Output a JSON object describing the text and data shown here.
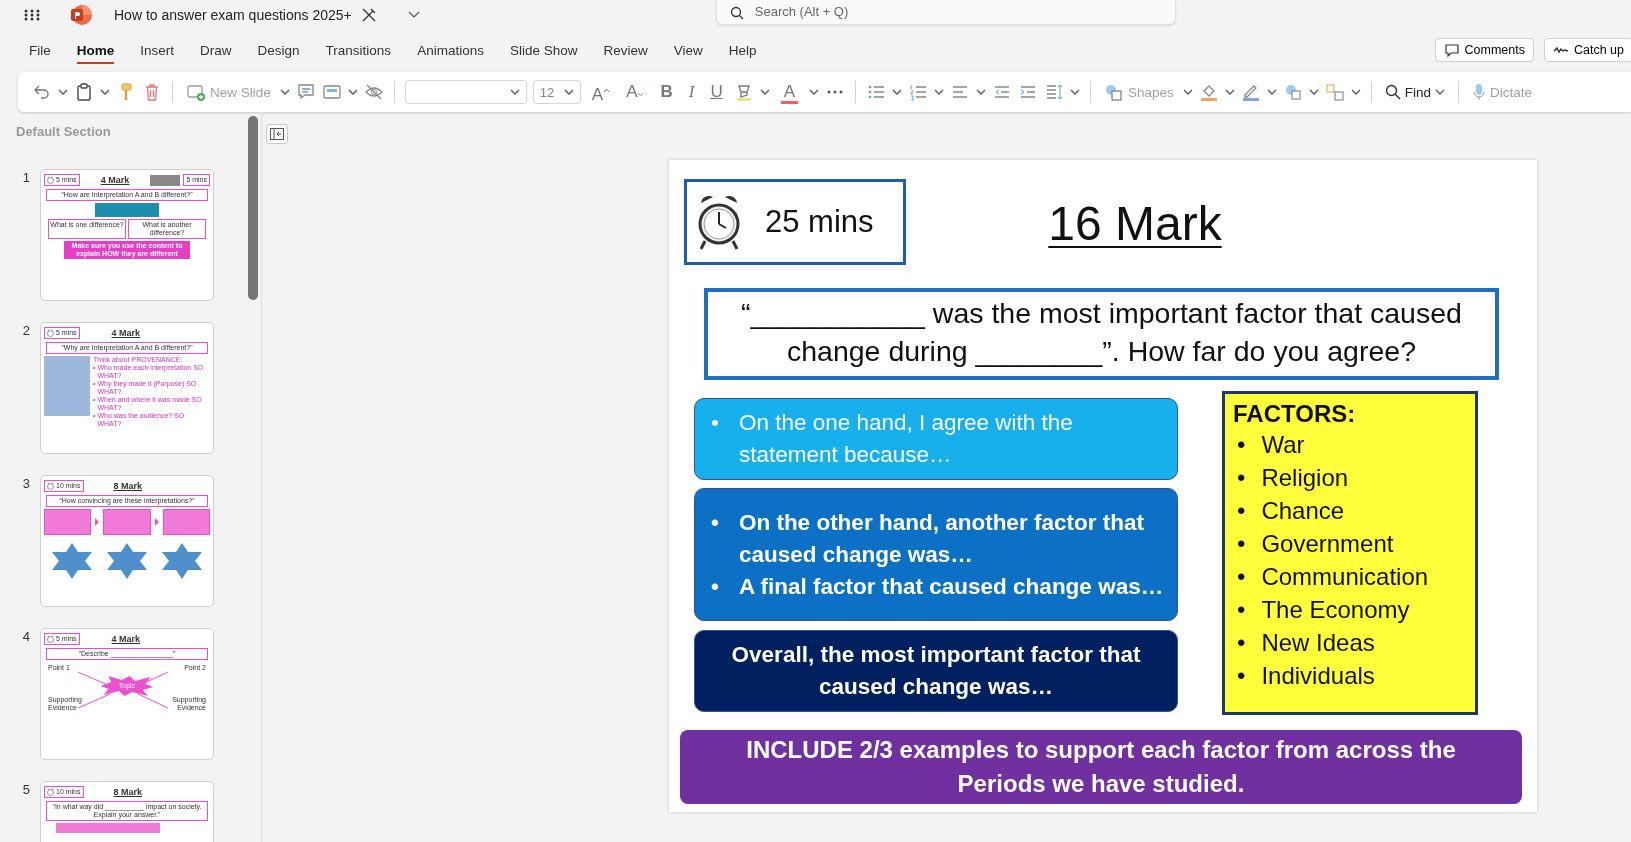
{
  "app": {
    "title": "How to answer exam questions 2025+",
    "search": {
      "placeholder": "Search (Alt + Q)"
    }
  },
  "tabs": [
    {
      "label": "File",
      "selected": false
    },
    {
      "label": "Home",
      "selected": true
    },
    {
      "label": "Insert",
      "selected": false
    },
    {
      "label": "Draw",
      "selected": false
    },
    {
      "label": "Design",
      "selected": false
    },
    {
      "label": "Transitions",
      "selected": false
    },
    {
      "label": "Animations",
      "selected": false
    },
    {
      "label": "Slide Show",
      "selected": false
    },
    {
      "label": "Review",
      "selected": false
    },
    {
      "label": "View",
      "selected": false
    },
    {
      "label": "Help",
      "selected": false
    }
  ],
  "header_buttons": [
    "Comments",
    "Catch up"
  ],
  "ribbon": {
    "new_slide": {
      "label": "New Slide",
      "disabled": true
    },
    "font_size": "12",
    "grow_font": "A",
    "shrink_font": "A",
    "bold": "B",
    "italic": "I",
    "underline": "U",
    "font_color": "A",
    "shapes": {
      "label": "Shapes",
      "disabled": true
    },
    "find": {
      "label": "Find",
      "disabled": false
    },
    "dictate": {
      "label": "Dictate",
      "disabled": true
    }
  },
  "slide_pane": {
    "section": "Default Section",
    "slides": [
      {
        "number": "1",
        "kind": "spot",
        "timer": "5 mins",
        "title": "4 Mark",
        "extra_timer": "5 mins",
        "question": "“How are Interpretation A and B different?”",
        "boxes": [
          "What is one difference?",
          "What is another difference?"
        ],
        "note": "Make sure you use the content to explain HOW they are different"
      },
      {
        "number": "2",
        "kind": "provenance",
        "timer": "5 mins",
        "title": "4 Mark",
        "question": "“Why are Interpretation A and B different?”",
        "heading": "Think about PROVENANCE:",
        "bullet": "•",
        "points": [
          "Who made each interpretation SO WHAT?",
          "Why they made it (Purpose) SO WHAT?",
          "When and where it was made SO WHAT?",
          "Who was the audience? SO WHAT?"
        ]
      },
      {
        "number": "3",
        "kind": "convincing",
        "timer": "10 mins",
        "title": "8 Mark",
        "question": "“How convincing are these interpretations?”"
      },
      {
        "number": "4",
        "kind": "mindmap",
        "timer": "5 mins",
        "title": "4 Mark",
        "question": "“Describe ________________”",
        "center": "Topic",
        "labels": [
          "Point 1",
          "Point 2",
          "Supporting Evidence",
          "Supporting Evidence"
        ]
      },
      {
        "number": "5",
        "kind": "question",
        "timer": "10 mins",
        "title": "8 Mark",
        "question": "“In what way did __________ impact on society. Explain your answer.”"
      }
    ]
  },
  "slide": {
    "timer": "25 mins",
    "bullet": "•",
    "title": "16 Mark",
    "question": "“___________ was the most important factor that caused change during ________”. How far do you agree?",
    "prompts": [
      {
        "kind": "light",
        "bullets": [
          "On the one hand, I agree with the statement because…"
        ]
      },
      {
        "kind": "medium",
        "bullets": [
          "On the other hand, another factor that caused change was…",
          "A final factor that caused change was…"
        ]
      },
      {
        "kind": "dark",
        "text": "Overall, the most important factor that caused change was…"
      }
    ],
    "factors": {
      "heading": "FACTORS:",
      "items": [
        "War",
        "Religion",
        "Chance",
        "Government",
        "Communication",
        "The Economy",
        "New Ideas",
        "Individuals"
      ]
    },
    "footer": "INCLUDE 2/3 examples to support each factor from across the Periods we have studied."
  }
}
